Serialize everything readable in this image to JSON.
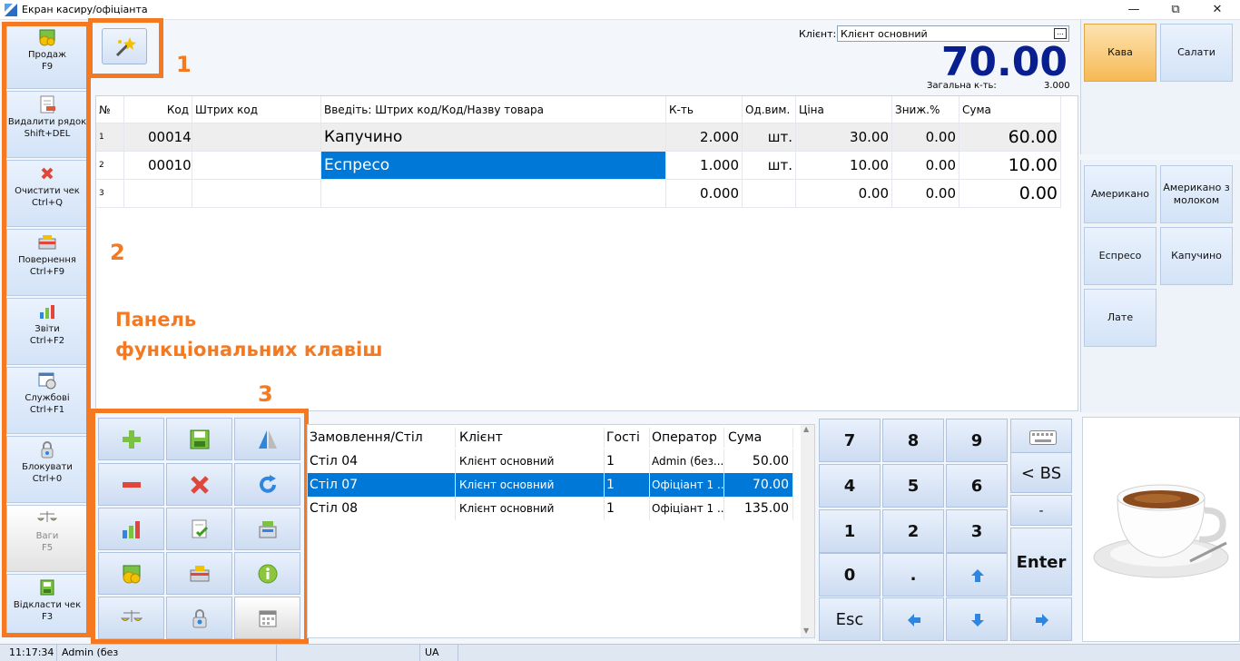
{
  "window": {
    "title": "Екран касиру/офіціанта",
    "controls": [
      "—",
      "⧉",
      "✕"
    ]
  },
  "fkeys": [
    {
      "label": "Продаж",
      "key": "F9",
      "icon": "coins-icon"
    },
    {
      "label": "Видалити рядок",
      "key": "Shift+DEL",
      "icon": "delete-row-icon"
    },
    {
      "label": "Очистити чек",
      "key": "Ctrl+Q",
      "icon": "clear-icon"
    },
    {
      "label": "Повернення",
      "key": "Ctrl+F9",
      "icon": "return-icon"
    },
    {
      "label": "Звіти",
      "key": "Ctrl+F2",
      "icon": "reports-icon"
    },
    {
      "label": "Службові",
      "key": "Ctrl+F1",
      "icon": "service-icon"
    },
    {
      "label": "Блокувати",
      "key": "Ctrl+0",
      "icon": "lock-icon"
    },
    {
      "label": "Ваги",
      "key": "F5",
      "icon": "scales-icon",
      "disabled": true
    },
    {
      "label": "Відкласти чек",
      "key": "F3",
      "icon": "postpone-icon"
    }
  ],
  "annotations": {
    "n1": "1",
    "n2": "2",
    "n3": "3",
    "panel_line1": "Панель",
    "panel_line2": "функціональних клавіш",
    "color": "#f47920"
  },
  "client": {
    "label": "Клієнт:",
    "value": "Клієнт основний"
  },
  "total": {
    "amount": "70.00",
    "qty_label": "Загальна к-ть:",
    "qty": "3.000"
  },
  "grid": {
    "headers": [
      "№",
      "Код",
      "Штрих код",
      "Введіть: Штрих код/Код/Назву товара",
      "К-ть",
      "Од.вим.",
      "Ціна",
      "Зниж.%",
      "Сума"
    ],
    "rows": [
      {
        "n": "1",
        "code": "00014",
        "barcode": "",
        "name": "Капучино",
        "qty": "2.000",
        "unit": "шт.",
        "price": "30.00",
        "disc": "0.00",
        "sum": "60.00"
      },
      {
        "n": "2",
        "code": "00010",
        "barcode": "",
        "name": "Еспресо",
        "qty": "1.000",
        "unit": "шт.",
        "price": "10.00",
        "disc": "0.00",
        "sum": "10.00"
      },
      {
        "n": "3",
        "code": "",
        "barcode": "",
        "name": "",
        "qty": "0.000",
        "unit": "",
        "price": "0.00",
        "disc": "0.00",
        "sum": "0.00"
      }
    ]
  },
  "orders": {
    "headers": [
      "Замовлення/Стіл",
      "Клієнт",
      "Гості",
      "Оператор",
      "Сума"
    ],
    "rows": [
      {
        "table": "Стіл 04",
        "client": "Клієнт основний",
        "guests": "1",
        "operator": "Admin (без...",
        "sum": "50.00"
      },
      {
        "table": "Стіл 07",
        "client": "Клієнт основний",
        "guests": "1",
        "operator": "Офіціант 1 ...",
        "sum": "70.00"
      },
      {
        "table": "Стіл 08",
        "client": "Клієнт основний",
        "guests": "1",
        "operator": "Офіціант 1 ...",
        "sum": "135.00"
      }
    ]
  },
  "keypad": {
    "k7": "7",
    "k8": "8",
    "k9": "9",
    "k4": "4",
    "k5": "5",
    "k6": "6",
    "k1": "1",
    "k2": "2",
    "k3": "3",
    "k0": "0",
    "dot": ".",
    "bs": "< BS",
    "minus": "-",
    "enter": "Enter",
    "esc": "Esc"
  },
  "categories": [
    "Кава",
    "Салати"
  ],
  "products": [
    "Американо",
    "Американо з молоком",
    "Еспресо",
    "Капучино",
    "Лате"
  ],
  "status": {
    "time": "11:17:34",
    "user": "Admin (без",
    "lang": "UA"
  },
  "colors": {
    "selection": "#0078d7",
    "total": "#0a1f8f",
    "active_category": "#f9c46b"
  }
}
